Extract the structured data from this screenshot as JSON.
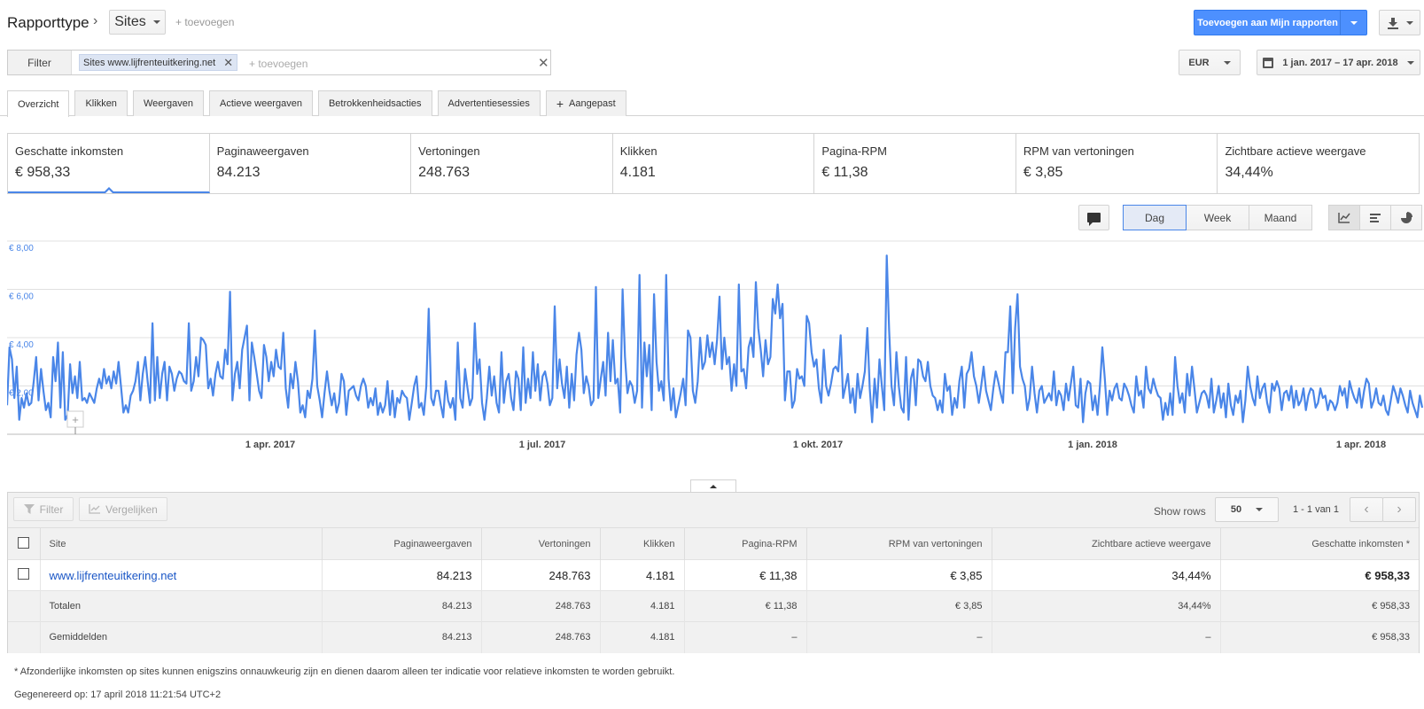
{
  "header": {
    "title": "Rapporttype",
    "dimension": "Sites",
    "add_label": "+ toevoegen",
    "add_to_reports": "Toevoegen aan Mijn rapporten"
  },
  "filterbar": {
    "label": "Filter",
    "chip": "Sites www.lijfrenteuitkering.net",
    "add_placeholder": "+ toevoegen",
    "currency": "EUR",
    "date_range": "1 jan. 2017 – 17 apr. 2018"
  },
  "tabs": [
    "Overzicht",
    "Klikken",
    "Weergaven",
    "Actieve weergaven",
    "Betrokkenheidsacties",
    "Advertentiesessies",
    "Aangepast"
  ],
  "metrics": [
    {
      "name": "Geschatte inkomsten",
      "value": "€ 958,33"
    },
    {
      "name": "Paginaweergaven",
      "value": "84.213"
    },
    {
      "name": "Vertoningen",
      "value": "248.763"
    },
    {
      "name": "Klikken",
      "value": "4.181"
    },
    {
      "name": "Pagina-RPM",
      "value": "€ 11,38"
    },
    {
      "name": "RPM van vertoningen",
      "value": "€ 3,85"
    },
    {
      "name": "Zichtbare actieve weergave",
      "value": "34,44%"
    }
  ],
  "periods": [
    "Dag",
    "Week",
    "Maand"
  ],
  "chart_data": {
    "type": "line",
    "y_ticks": [
      "€ 8,00",
      "€ 6,00",
      "€ 4,00",
      "€ 2,00"
    ],
    "ylim": [
      0,
      8
    ],
    "x_labels": [
      "1 apr. 2017",
      "1 jul. 2017",
      "1 okt. 2017",
      "1 jan. 2018",
      "1 apr. 2018"
    ],
    "color": "#4a86e8",
    "values": [
      1.2,
      3.6,
      3.1,
      1.5,
      2.8,
      0.6,
      1.5,
      1.1,
      1.7,
      1.2,
      1.3,
      2.2,
      3.2,
      1.4,
      2.7,
      1.8,
      1.0,
      1.3,
      0.7,
      3.2,
      2.2,
      3.8,
      1.1,
      3.4,
      0.6,
      0.8,
      2.9,
      1.7,
      2.4,
      1.5,
      3.0,
      1.4,
      1.5,
      1.3,
      1.7,
      1.5,
      1.3,
      1.9,
      2.3,
      1.9,
      2.7,
      2.1,
      2.4,
      1.9,
      2.6,
      2.1,
      3.0,
      2.0,
      0.9,
      1.2,
      0.9,
      1.6,
      1.8,
      2.2,
      3.0,
      1.4,
      2.5,
      3.2,
      2.2,
      1.3,
      4.6,
      1.4,
      3.2,
      1.5,
      2.5,
      3.0,
      1.4,
      2.8,
      2.5,
      1.8,
      2.3,
      2.6,
      2.5,
      2.2,
      2.1,
      4.6,
      1.8,
      2.2,
      3.2,
      2.4,
      4.0,
      3.9,
      3.7,
      1.9,
      2.3,
      1.6,
      2.5,
      3.0,
      2.4,
      2.3,
      3.5,
      2.9,
      5.9,
      1.4,
      2.5,
      3.0,
      1.9,
      3.5,
      4.0,
      4.5,
      1.4,
      3.8,
      3.2,
      2.5,
      1.8,
      1.5,
      3.7,
      3.2,
      2.2,
      3.0,
      2.4,
      3.5,
      2.8,
      2.7,
      4.2,
      1.9,
      1.1,
      2.5,
      1.9,
      3.0,
      2.2,
      0.9,
      1.2,
      0.7,
      1.8,
      1.5,
      2.3,
      4.3,
      2.0,
      1.4,
      0.7,
      1.7,
      2.6,
      1.8,
      1.2,
      1.7,
      0.9,
      1.3,
      2.5,
      2.2,
      0.8,
      1.8,
      1.9,
      2.0,
      1.6,
      1.4,
      2.0,
      2.3,
      2.0,
      1.1,
      1.5,
      1.2,
      1.9,
      0.8,
      1.3,
      0.9,
      1.2,
      2.2,
      0.8,
      1.8,
      0.7,
      1.5,
      1.3,
      1.8,
      1.6,
      1.5,
      0.6,
      1.3,
      2.0,
      2.4,
      1.1,
      1.3,
      0.8,
      2.0,
      5.2,
      1.5,
      1.2,
      1.8,
      1.8,
      1.2,
      0.7,
      2.2,
      1.4,
      1.1,
      1.5,
      0.6,
      3.8,
      1.5,
      1.1,
      2.7,
      1.9,
      1.2,
      1.5,
      4.6,
      2.5,
      3.1,
      1.3,
      0.6,
      1.5,
      2.8,
      1.6,
      2.4,
      1.3,
      0.9,
      3.4,
      1.3,
      2.2,
      2.5,
      1.5,
      1.0,
      2.6,
      2.3,
      1.0,
      3.6,
      1.3,
      2.3,
      1.5,
      3.4,
      1.8,
      2.9,
      1.4,
      2.4,
      2.6,
      2.1,
      1.2,
      1.5,
      5.3,
      1.9,
      3.1,
      2.1,
      1.5,
      2.8,
      1.1,
      2.5,
      1.4,
      3.3,
      4.2,
      3.5,
      1.7,
      2.4,
      2.0,
      1.2,
      1.4,
      6.1,
      1.5,
      2.3,
      3.0,
      1.6,
      4.2,
      2.2,
      3.9,
      2.1,
      2.3,
      0.9,
      6.0,
      3.2,
      1.7,
      2.2,
      2.0,
      1.3,
      1.8,
      6.6,
      1.1,
      3.8,
      2.4,
      3.7,
      1.0,
      5.8,
      3.0,
      1.8,
      2.2,
      1.4,
      6.6,
      2.3,
      1.0,
      1.9,
      0.7,
      1.2,
      1.7,
      2.3,
      1.2,
      4.3,
      4.0,
      1.8,
      1.3,
      2.2,
      4.0,
      2.7,
      3.0,
      4.1,
      3.2,
      3.8,
      2.9,
      3.9,
      5.7,
      2.7,
      4.0,
      2.9,
      3.2,
      1.8,
      2.9,
      2.0,
      6.2,
      2.6,
      2.7,
      1.9,
      3.6,
      4.0,
      3.2,
      6.3,
      4.4,
      3.5,
      2.4,
      3.9,
      2.9,
      3.2,
      5.6,
      5.0,
      6.2,
      4.8,
      5.4,
      1.4,
      2.6,
      2.6,
      1.1,
      1.4,
      2.7,
      2.3,
      2.4,
      2.0,
      4.9,
      4.6,
      3.4,
      2.8,
      3.1,
      1.9,
      1.3,
      3.5,
      2.0,
      1.6,
      2.1,
      2.7,
      2.8,
      2.6,
      4.1,
      1.5,
      2.0,
      2.5,
      1.3,
      1.9,
      0.9,
      2.5,
      1.5,
      2.0,
      2.6,
      4.4,
      1.9,
      0.5,
      2.3,
      1.1,
      3.1,
      2.0,
      1.0,
      7.4,
      4.3,
      2.0,
      1.2,
      3.4,
      2.0,
      1.1,
      0.9,
      3.2,
      0.6,
      2.3,
      2.7,
      1.2,
      3.1,
      3.0,
      2.4,
      2.2,
      3.0,
      2.0,
      1.6,
      1.5,
      1.0,
      1.4,
      0.9,
      2.5,
      1.8,
      2.0,
      0.8,
      1.5,
      1.1,
      2.2,
      2.8,
      1.1,
      2.5,
      2.7,
      3.4,
      2.4,
      2.0,
      1.3,
      2.0,
      2.8,
      1.8,
      1.4,
      1.0,
      1.9,
      2.6,
      2.2,
      1.7,
      1.3,
      3.4,
      3.4,
      5.3,
      1.7,
      4.4,
      5.8,
      2.8,
      2.3,
      2.0,
      1.0,
      1.5,
      2.8,
      1.7,
      0.9,
      1.8,
      2.0,
      1.3,
      1.5,
      1.7,
      1.4,
      2.6,
      1.2,
      1.8,
      1.6,
      1.0,
      2.1,
      1.4,
      2.1,
      2.8,
      1.2,
      1.1,
      2.3,
      0.5,
      1.7,
      2.2,
      2.1,
      1.0,
      1.6,
      0.8,
      2.0,
      3.6,
      2.3,
      0.8,
      1.8,
      1.4,
      1.9,
      2.1,
      1.5,
      1.4,
      2.1,
      1.9,
      1.6,
      1.2,
      0.9,
      2.4,
      1.6,
      1.8,
      1.1,
      2.8,
      1.9,
      1.7,
      2.3,
      1.9,
      1.6,
      1.5,
      0.6,
      1.3,
      0.8,
      1.7,
      0.8,
      3.2,
      2.0,
      1.3,
      1.7,
      0.9,
      2.5,
      1.6,
      2.8,
      1.9,
      0.9,
      1.3,
      1.7,
      1.8,
      1.6,
      1.1,
      2.3,
      0.9,
      1.4,
      2.0,
      1.1,
      1.7,
      0.7,
      2.1,
      1.2,
      0.8,
      1.6,
      1.3,
      1.8,
      0.5,
      1.4,
      2.8,
      2.0,
      1.5,
      1.2,
      2.4,
      1.5,
      1.9,
      2.1,
      1.3,
      0.9,
      2.1,
      1.8,
      2.2,
      1.9,
      1.0,
      1.7,
      1.8,
      1.4,
      2.0,
      1.1,
      1.8,
      1.2,
      1.4,
      1.9,
      1.0,
      1.6,
      1.9,
      1.8,
      1.1,
      1.3,
      1.9,
      1.5,
      1.6,
      1.0,
      1.4,
      1.3,
      1.0,
      1.3,
      2.0,
      1.6,
      1.9,
      1.1,
      2.2,
      1.8,
      1.5,
      1.3,
      1.9,
      1.1,
      1.8,
      2.3,
      2.1,
      1.1,
      1.4,
      1.9,
      1.3,
      1.2,
      1.6,
      1.0,
      0.8,
      1.4,
      2.0,
      1.7,
      1.3,
      1.9,
      1.6,
      1.2,
      0.9,
      1.8,
      1.3,
      1.0,
      0.7,
      1.6,
      1.1
    ]
  },
  "table_toolbar": {
    "filter": "Filter",
    "compare": "Vergelijken",
    "show_rows_label": "Show rows",
    "rows_value": "50",
    "range": "1 - 1 van 1"
  },
  "table": {
    "columns": [
      "Site",
      "Paginaweergaven",
      "Vertoningen",
      "Klikken",
      "Pagina-RPM",
      "RPM van vertoningen",
      "Zichtbare actieve weergave",
      "Geschatte inkomsten *"
    ],
    "rows": [
      [
        "www.lijfrenteuitkering.net",
        "84.213",
        "248.763",
        "4.181",
        "€ 11,38",
        "€ 3,85",
        "34,44%",
        "€ 958,33"
      ]
    ],
    "totals": [
      "Totalen",
      "84.213",
      "248.763",
      "4.181",
      "€ 11,38",
      "€ 3,85",
      "34,44%",
      "€ 958,33"
    ],
    "averages": [
      "Gemiddelden",
      "84.213",
      "248.763",
      "4.181",
      "–",
      "–",
      "–",
      "€ 958,33"
    ]
  },
  "footer": {
    "note": "* Afzonderlijke inkomsten op sites kunnen enigszins onnauwkeurig zijn en dienen daarom alleen ter indicatie voor relatieve inkomsten te worden gebruikt.",
    "generated": "Gegenereerd op: 17 april 2018 11:21:54 UTC+2"
  }
}
